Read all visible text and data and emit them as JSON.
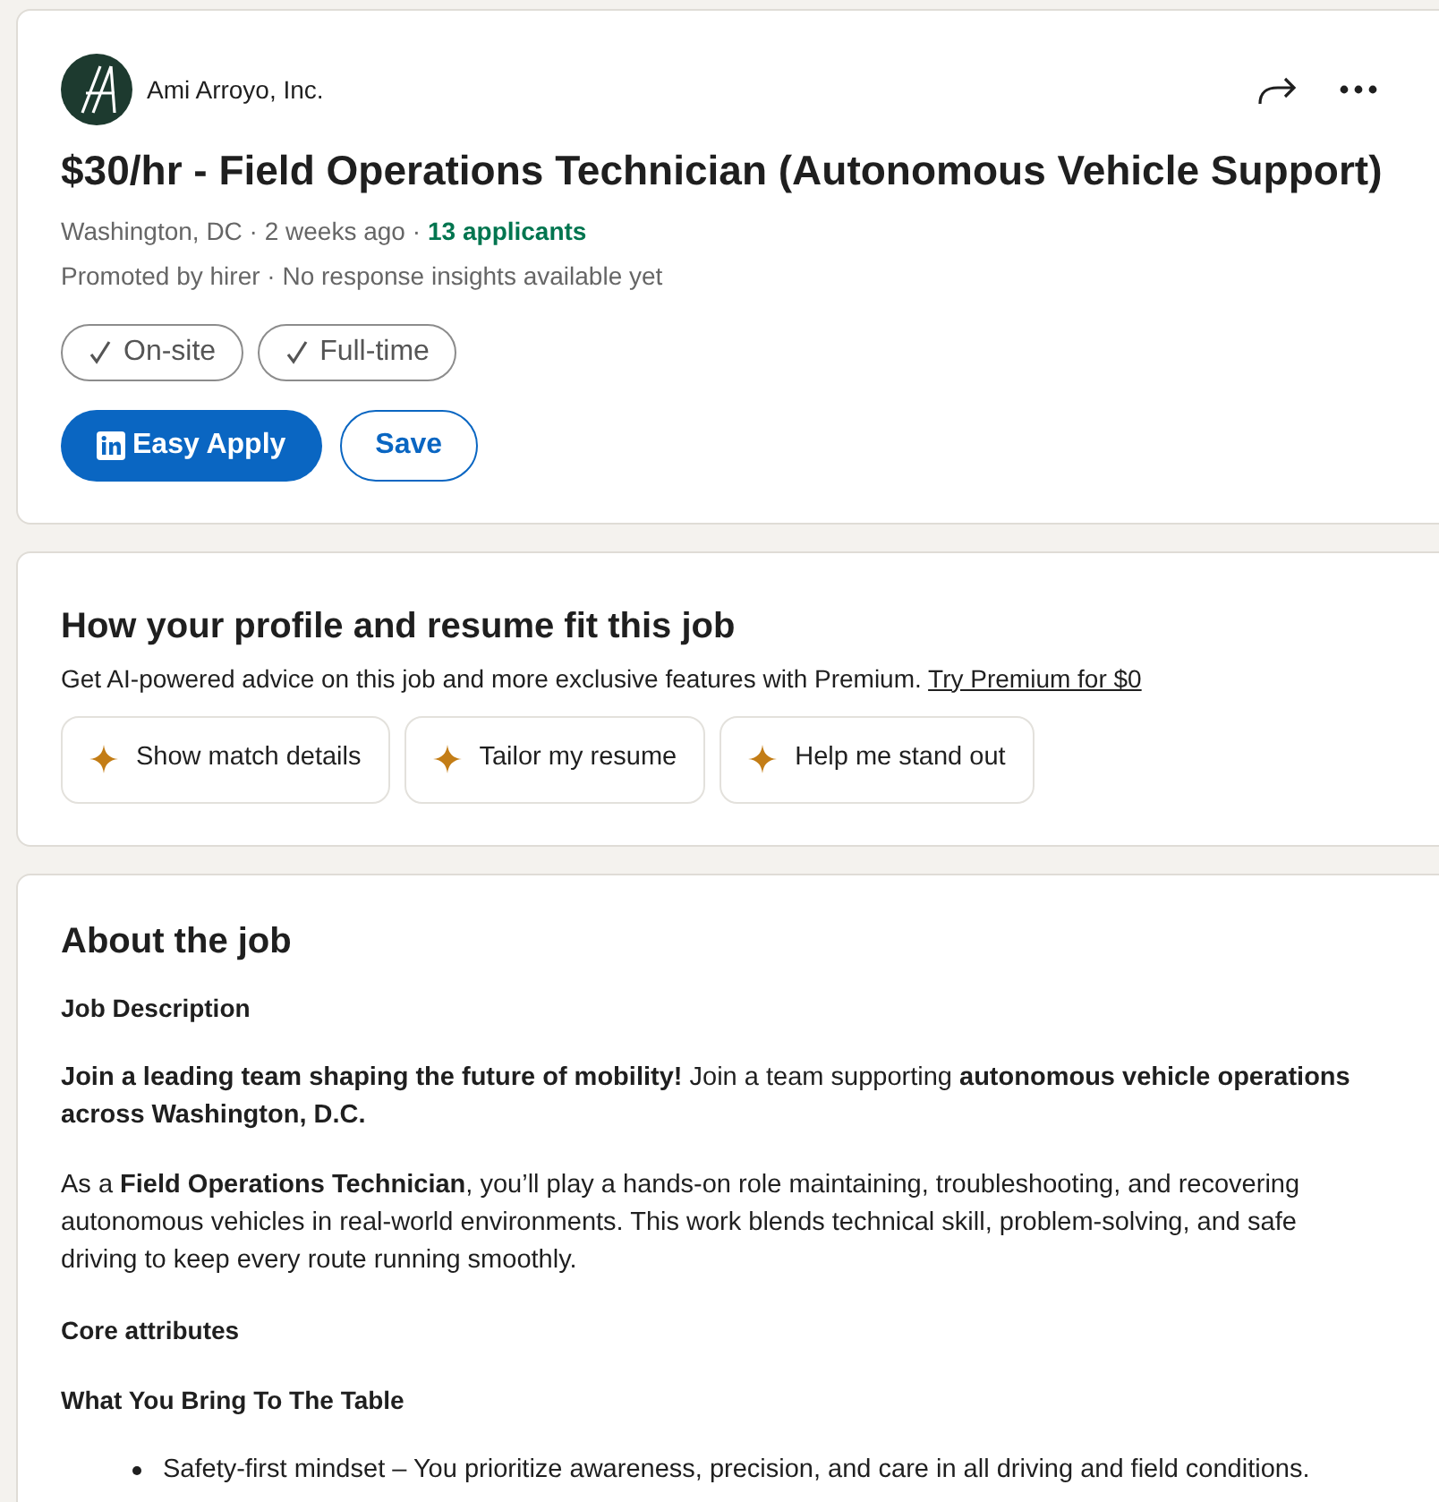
{
  "job_card": {
    "company": "Ami Arroyo, Inc.",
    "title": "$30/hr - Field Operations Technician (Autonomous Vehicle Support)",
    "meta": [
      {
        "text": "Washington, DC · 2 weeks ago ·",
        "kind": "plain"
      },
      {
        "text": "13 applicants",
        "kind": "highlight"
      }
    ],
    "insight": "Promoted by hirer · No response insights available yet",
    "tags": [
      "On-site",
      "Full-time"
    ],
    "apply_button": "Easy Apply",
    "save_button": "Save"
  },
  "fit_card": {
    "heading": "How your profile and resume fit this job",
    "text": "Get AI-powered advice on this job and more exclusive features with Premium.",
    "link": "Try Premium for $0",
    "actions": [
      "Show match details",
      "Tailor my resume",
      "Help me stand out"
    ]
  },
  "about": {
    "heading": "About the job",
    "blocks": [
      {
        "kind": "subheading",
        "text": "Job Description"
      },
      {
        "kind": "paragraph",
        "text": "**Join a leading team shaping the future of mobility!** Join a team supporting **autonomous vehicle operations across Washington, D.C.**"
      },
      {
        "kind": "paragraph",
        "text": "As a **Field Operations Technician**, you’ll play a hands-on role maintaining, troubleshooting, and recovering autonomous vehicles in real-world environments. This work blends technical skill, problem-solving, and safe driving to keep every route running smoothly."
      },
      {
        "kind": "subheading",
        "text": "Core attributes"
      },
      {
        "kind": "subheading",
        "text": "What You Bring To The Table"
      },
      {
        "kind": "bullet",
        "text": "Safety-first mindset – You prioritize awareness, precision, and care in all driving and field conditions."
      }
    ]
  }
}
